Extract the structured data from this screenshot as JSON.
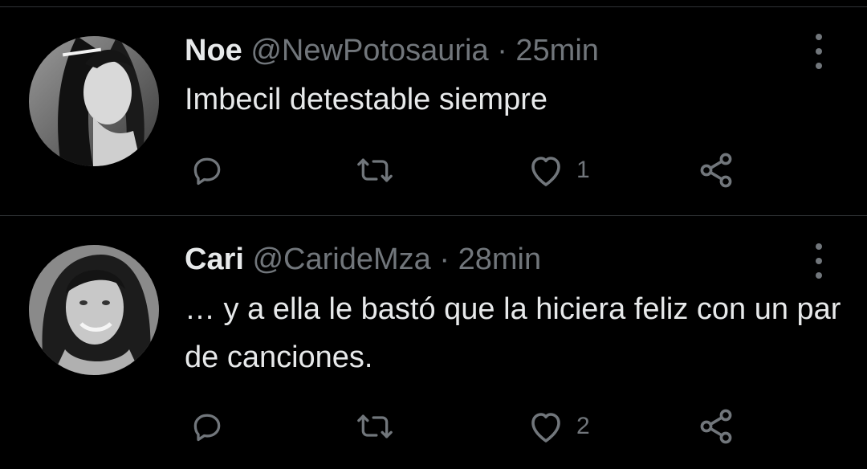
{
  "tweets": [
    {
      "name": "Noe",
      "handle": "@NewPotosauria",
      "separator": "·",
      "time": "25min",
      "text": "Imbecil detestable siempre",
      "reply_count": "",
      "retweet_count": "",
      "like_count": "1"
    },
    {
      "name": "Cari",
      "handle": "@CarideMza",
      "separator": "·",
      "time": "28min",
      "text": "… y a ella le bastó que la hiciera feliz con un par de canciones.",
      "reply_count": "",
      "retweet_count": "",
      "like_count": "2"
    }
  ],
  "icons": [
    "reply-icon",
    "retweet-icon",
    "like-icon",
    "share-icon",
    "more-options-icon"
  ],
  "colors": {
    "background": "#000000",
    "primary_text": "#e7e9ea",
    "secondary_text": "#71767b",
    "divider": "#2f3336"
  }
}
